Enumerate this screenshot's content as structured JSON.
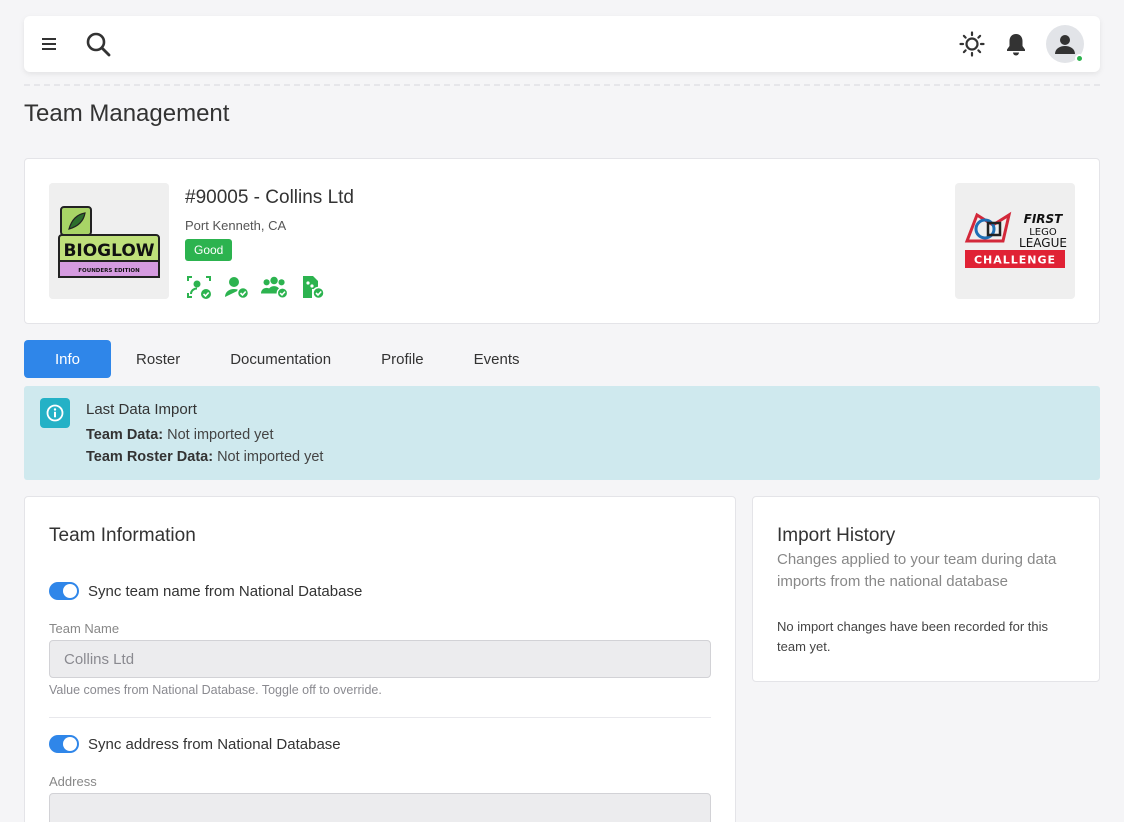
{
  "header": {
    "menu_icon": "hamburger-menu-icon",
    "search_icon": "search-icon",
    "theme_icon": "sun-icon",
    "notifications_icon": "bell-icon",
    "avatar_icon": "user-icon",
    "online_color": "#2bb24c"
  },
  "page": {
    "title": "Team Management"
  },
  "team": {
    "number_name": "#90005 - Collins Ltd",
    "location": "Port Kenneth, CA",
    "status_badge": "Good",
    "status_color": "#2cb34f",
    "team_logo": {
      "text": "BIOGLOW",
      "subtext": "FOUNDERS EDITION"
    },
    "program_logo": {
      "line1": "FIRST",
      "line2": "LEGO",
      "line3": "LEAGUE",
      "banner": "CHALLENGE"
    },
    "status_icons": [
      "user-scan-check-icon",
      "user-check-icon",
      "group-check-icon",
      "document-check-icon"
    ]
  },
  "tabs": [
    {
      "label": "Info",
      "active": true
    },
    {
      "label": "Roster",
      "active": false
    },
    {
      "label": "Documentation",
      "active": false
    },
    {
      "label": "Profile",
      "active": false
    },
    {
      "label": "Events",
      "active": false
    }
  ],
  "import_alert": {
    "icon": "info-icon",
    "title": "Last Data Import",
    "team_data_label": "Team Data:",
    "team_data_value": "Not imported yet",
    "roster_data_label": "Team Roster Data:",
    "roster_data_value": "Not imported yet"
  },
  "team_info": {
    "title": "Team Information",
    "sync_name_label": "Sync team name from National Database",
    "sync_name_on": true,
    "team_name_label": "Team Name",
    "team_name_value": "Collins Ltd",
    "team_name_help": "Value comes from National Database. Toggle off to override.",
    "sync_address_label": "Sync address from National Database",
    "sync_address_on": true,
    "address_label": "Address",
    "address_value": ""
  },
  "import_history": {
    "title": "Import History",
    "subtitle": "Changes applied to your team during data imports from the national database",
    "empty_message": "No import changes have been recorded for this team yet."
  },
  "colors": {
    "primary": "#2f86e9",
    "alert_bg": "#cfe9ee",
    "alert_icon": "#24b1c6",
    "success": "#2cb34f"
  }
}
